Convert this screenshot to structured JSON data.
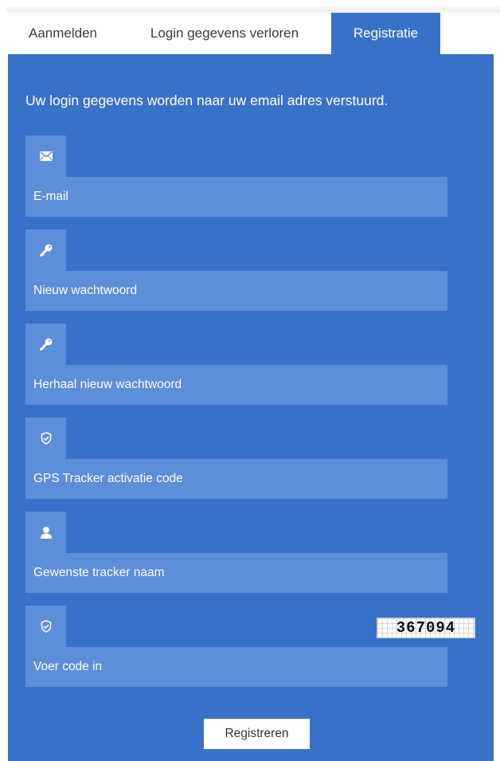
{
  "tabs": [
    {
      "label": "Aanmelden",
      "active": false
    },
    {
      "label": "Login gegevens verloren",
      "active": false
    },
    {
      "label": "Registratie",
      "active": true
    }
  ],
  "form": {
    "intro": "Uw login gegevens worden naar uw email adres verstuurd.",
    "fields": [
      {
        "icon": "envelope-icon",
        "placeholder": "E-mail",
        "value": ""
      },
      {
        "icon": "key-icon",
        "placeholder": "Nieuw wachtwoord",
        "value": ""
      },
      {
        "icon": "key-icon",
        "placeholder": "Herhaal nieuw wachtwoord",
        "value": ""
      },
      {
        "icon": "shield-check-icon",
        "placeholder": "GPS Tracker activatie code",
        "value": ""
      },
      {
        "icon": "user-icon",
        "placeholder": "Gewenste tracker naam",
        "value": ""
      },
      {
        "icon": "shield-check-icon",
        "placeholder": "Voer code in",
        "value": ""
      }
    ],
    "captcha_code": "367094",
    "submit_label": "Registreren"
  },
  "colors": {
    "panel": "#3a71c8",
    "field": "#5c8ed9",
    "text": "#ffffff"
  }
}
